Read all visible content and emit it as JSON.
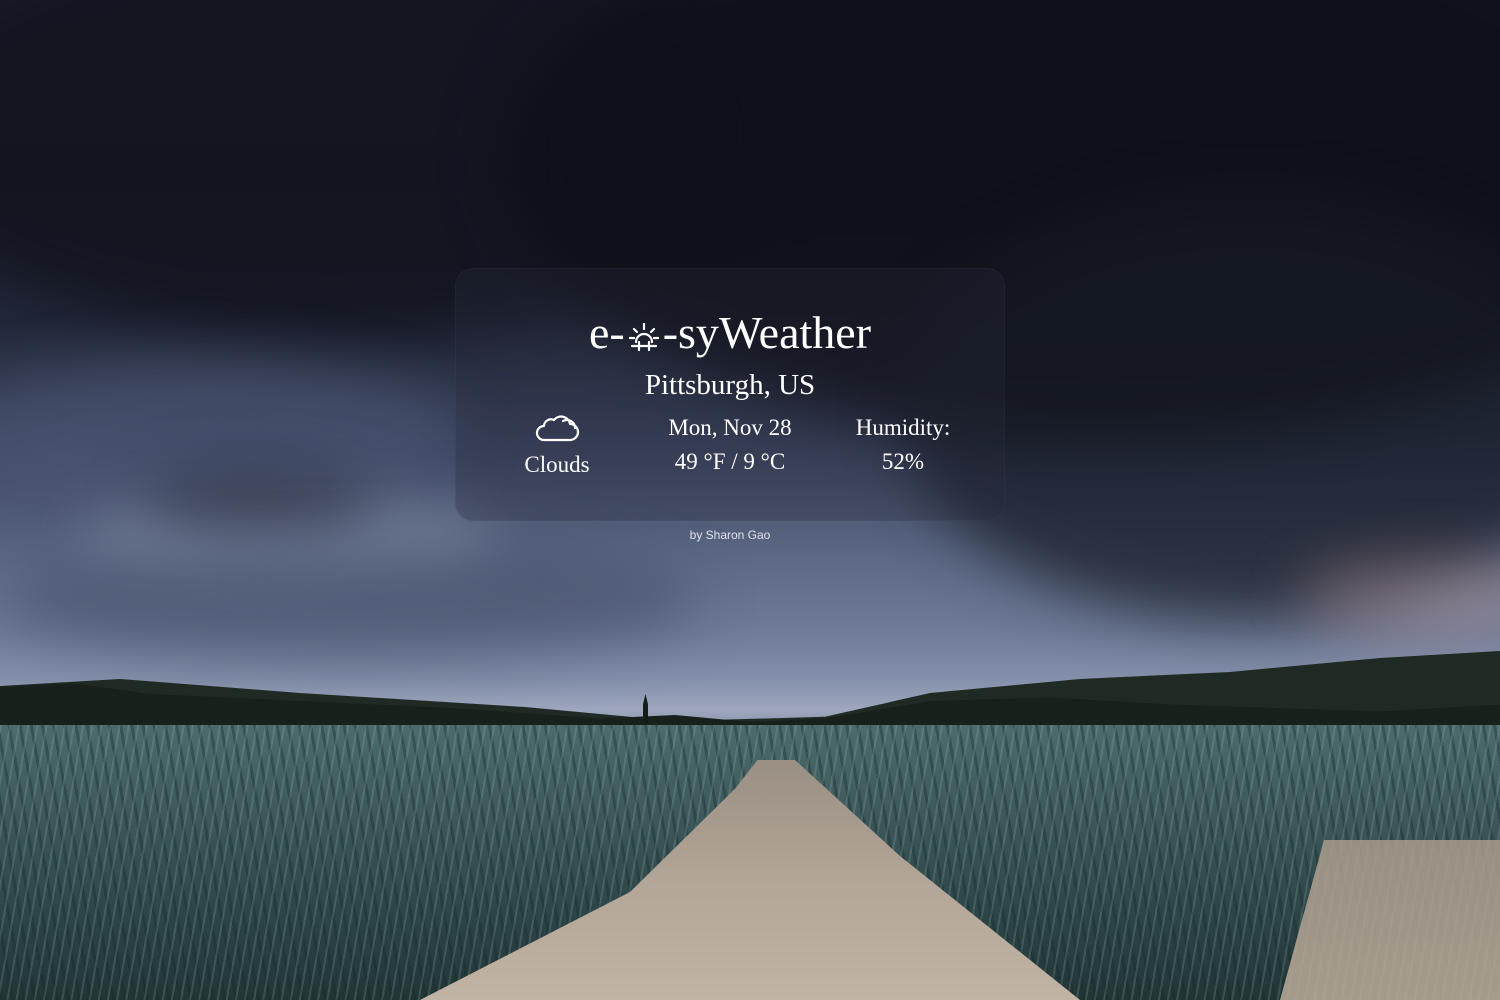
{
  "app": {
    "brand_prefix": "e-",
    "brand_middle": "-sy",
    "brand_suffix": "Weather",
    "brand_icon": "sun-icon"
  },
  "location": {
    "city": "Pittsburgh, US"
  },
  "weather": {
    "condition_icon": "cloud-icon",
    "condition": "Clouds",
    "date": "Mon, Nov 28",
    "temperature": "49 °F / 9 °C",
    "humidity_label": "Humidity:",
    "humidity_value": "52%"
  },
  "footer": {
    "credit": "by Sharon Gao"
  },
  "colors": {
    "text": "#ffffff",
    "card_background": "rgba(40,44,58,0.30)"
  }
}
